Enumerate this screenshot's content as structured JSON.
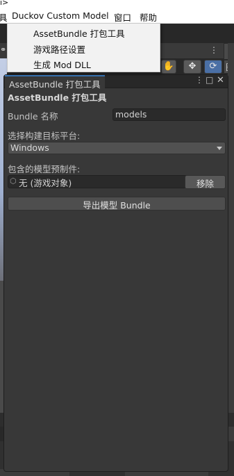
{
  "menubar": {
    "cut_text": "ı>",
    "left_fragment": "具",
    "items": [
      "Duckov Custom Model",
      "窗口",
      "帮助"
    ]
  },
  "dropdown": {
    "items": [
      "AssetBundle 打包工具",
      "游戏路径设置",
      "生成 Mod DLL"
    ]
  },
  "scene": {
    "toolbar_icons": [
      "hand-icon",
      "move-icon",
      "rotate-icon"
    ],
    "active_tool": "rotate-icon",
    "right_fragment": "图"
  },
  "window": {
    "tab_label": "AssetBundle 打包工具",
    "heading": "AssetBundle 打包工具",
    "bundle_name_label": "Bundle 名称",
    "bundle_name_value": "models",
    "platform_label": "选择构建目标平台:",
    "platform_value": "Windows",
    "prefabs_label": "包含的模型预制件:",
    "prefab_field_value": "无 (游戏对象)",
    "remove_button": "移除",
    "export_button": "导出模型 Bundle"
  }
}
